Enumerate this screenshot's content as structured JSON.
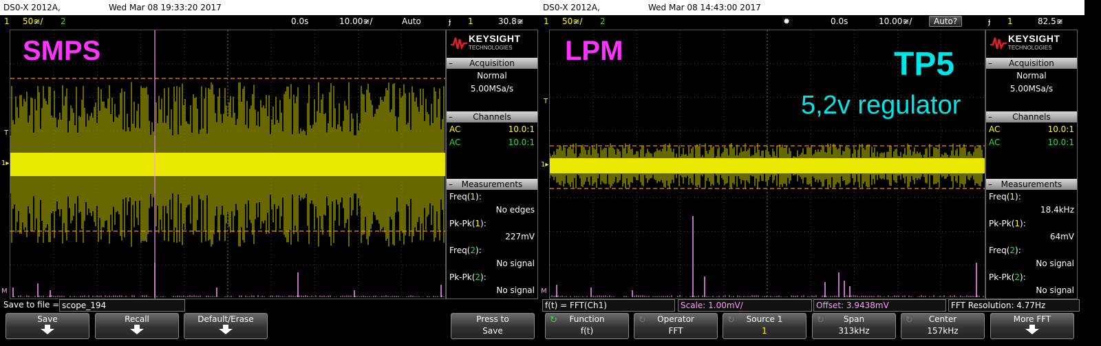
{
  "left": {
    "header": {
      "model": "DS0-X 2012A,",
      "datetime": "Wed Mar 08 19:33:20 2017"
    },
    "status": {
      "ch1_num": "1",
      "ch1_scale": "50≆/",
      "ch2_num": "2",
      "time_delay": "0.0s",
      "time_scale": "10.00≆/",
      "trigger_mode": "Auto",
      "trig_icon": "ɟ",
      "trig_src": "1",
      "trig_level": "30.8≆"
    },
    "annotation": {
      "label": "SMPS",
      "color": "#ff33ff"
    },
    "panel": {
      "brand": "KEYSIGHT",
      "brand_sub": "TECHNOLOGIES",
      "acq_title": "Acquisition",
      "acq_mode": "Normal",
      "acq_rate": "5.00MSa/s",
      "chan_title": "Channels",
      "ch1_coupling": "AC",
      "ch1_probe": "10.0:1",
      "ch2_coupling": "AC",
      "ch2_probe": "10.0:1",
      "meas_title": "Measurements",
      "m1_label": "Freq(",
      "m1_ch": "1",
      "m1_close": "):",
      "m1_value": "No edges",
      "m2_label": "Pk-Pk(",
      "m2_ch": "1",
      "m2_close": "):",
      "m2_value": "227mV",
      "m3_label": "Freq(",
      "m3_ch": "2",
      "m3_close": "):",
      "m3_value": "No signal",
      "m4_label": "Pk-Pk(",
      "m4_ch": "2",
      "m4_close": "):",
      "m4_value": "No signal"
    },
    "footer": {
      "save_label": "Save to file =",
      "filename": "scope_194"
    },
    "softkeys": [
      {
        "l1": "Save"
      },
      {
        "l1": "Recall"
      },
      {
        "l1": "Default/Erase"
      },
      {
        "l1": "Press to",
        "l2": "Save"
      }
    ]
  },
  "right": {
    "header": {
      "model": "DS0-X 2012A,",
      "datetime": "Wed Mar 08 14:43:00 2017"
    },
    "status": {
      "ch1_num": "1",
      "ch1_scale": "50≆/",
      "ch2_num": "2",
      "run_icon": "✹",
      "time_delay": "0.0s",
      "time_scale": "10.00≆/",
      "trigger_mode": "Auto?",
      "trig_icon": "ɟ",
      "trig_src": "1",
      "trig_level": "82.5≆"
    },
    "annotation": {
      "label": "LPM",
      "color": "#ff33ff",
      "tp_label": "TP5",
      "tp_sub": "5,2v regulator",
      "tp_color": "#00e5e5"
    },
    "panel": {
      "brand": "KEYSIGHT",
      "brand_sub": "TECHNOLOGIES",
      "acq_title": "Acquisition",
      "acq_mode": "Normal",
      "acq_rate": "5.00MSa/s",
      "chan_title": "Channels",
      "ch1_coupling": "AC",
      "ch1_probe": "10.0:1",
      "ch2_coupling": "AC",
      "ch2_probe": "10.0:1",
      "meas_title": "Measurements",
      "m1_label": "Freq(",
      "m1_ch": "1",
      "m1_close": "):",
      "m1_value": "18.4kHz",
      "m2_label": "Pk-Pk(",
      "m2_ch": "1",
      "m2_close": "):",
      "m2_value": "64mV",
      "m3_label": "Freq(",
      "m3_ch": "2",
      "m3_close": "):",
      "m3_value": "No signal",
      "m4_label": "Pk-Pk(",
      "m4_ch": "2",
      "m4_close": "):",
      "m4_value": "No signal"
    },
    "footer": {
      "fx": "f(t) = FFT(Ch1)",
      "scale": "Scale: 1.00mV/",
      "offset": "Offset: 3.9438mV",
      "resolution": "FFT Resolution: 4.77Hz"
    },
    "softkeys": [
      {
        "l1": "Function",
        "l2": "f(t)"
      },
      {
        "l1": "Operator",
        "l2": "FFT"
      },
      {
        "l1": "Source 1",
        "l2": "1"
      },
      {
        "l1": "Span",
        "l2": "313kHz"
      },
      {
        "l1": "Center",
        "l2": "157kHz"
      },
      {
        "l1": "More FFT"
      }
    ]
  },
  "colors": {
    "trace": "#ffff00",
    "fft": "#ff99ff",
    "grid": "#444444",
    "ref": "#ff8800",
    "ch2": "#33dd33"
  },
  "icons": {
    "undo": "undo-icon",
    "arrow": "down-arrow-icon"
  }
}
